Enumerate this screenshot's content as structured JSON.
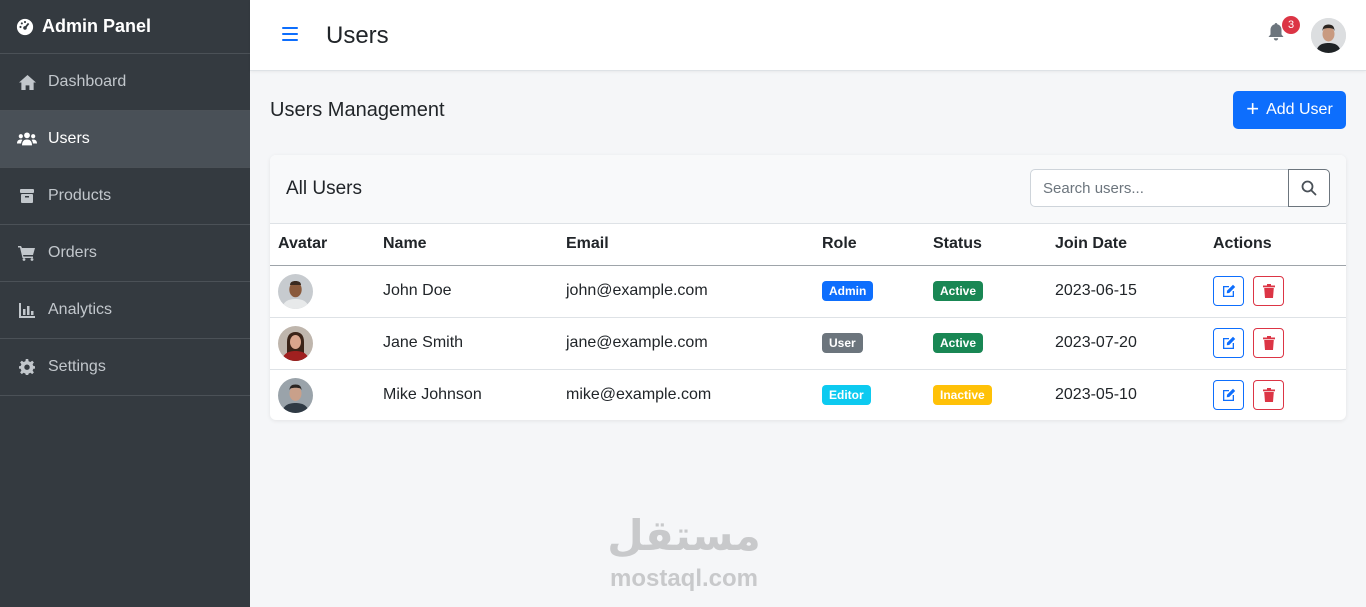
{
  "sidebar": {
    "brand": "Admin Panel",
    "items": [
      {
        "label": "Dashboard",
        "icon": "home-icon",
        "active": false
      },
      {
        "label": "Users",
        "icon": "users-icon",
        "active": true
      },
      {
        "label": "Products",
        "icon": "box-icon",
        "active": false
      },
      {
        "label": "Orders",
        "icon": "cart-icon",
        "active": false
      },
      {
        "label": "Analytics",
        "icon": "chart-icon",
        "active": false
      },
      {
        "label": "Settings",
        "icon": "gear-icon",
        "active": false
      }
    ]
  },
  "header": {
    "title": "Users",
    "notification_count": "3"
  },
  "main": {
    "section_title": "Users Management",
    "add_button": "Add User",
    "card_title": "All Users",
    "search_placeholder": "Search users...",
    "columns": [
      "Avatar",
      "Name",
      "Email",
      "Role",
      "Status",
      "Join Date",
      "Actions"
    ],
    "rows": [
      {
        "name": "John Doe",
        "email": "john@example.com",
        "role": "Admin",
        "status": "Active",
        "join_date": "2023-06-15"
      },
      {
        "name": "Jane Smith",
        "email": "jane@example.com",
        "role": "User",
        "status": "Active",
        "join_date": "2023-07-20"
      },
      {
        "name": "Mike Johnson",
        "email": "mike@example.com",
        "role": "Editor",
        "status": "Inactive",
        "join_date": "2023-05-10"
      }
    ]
  },
  "colors": {
    "sidebar_bg": "#343a40",
    "primary": "#0d6efd",
    "danger": "#dc3545",
    "role_admin": "#0d6efd",
    "role_user": "#6c757d",
    "role_editor": "#0dcaf0",
    "status_active": "#198754",
    "status_inactive": "#ffc107"
  },
  "watermark": {
    "arabic": "مستقل",
    "latin": "mostaql.com"
  }
}
